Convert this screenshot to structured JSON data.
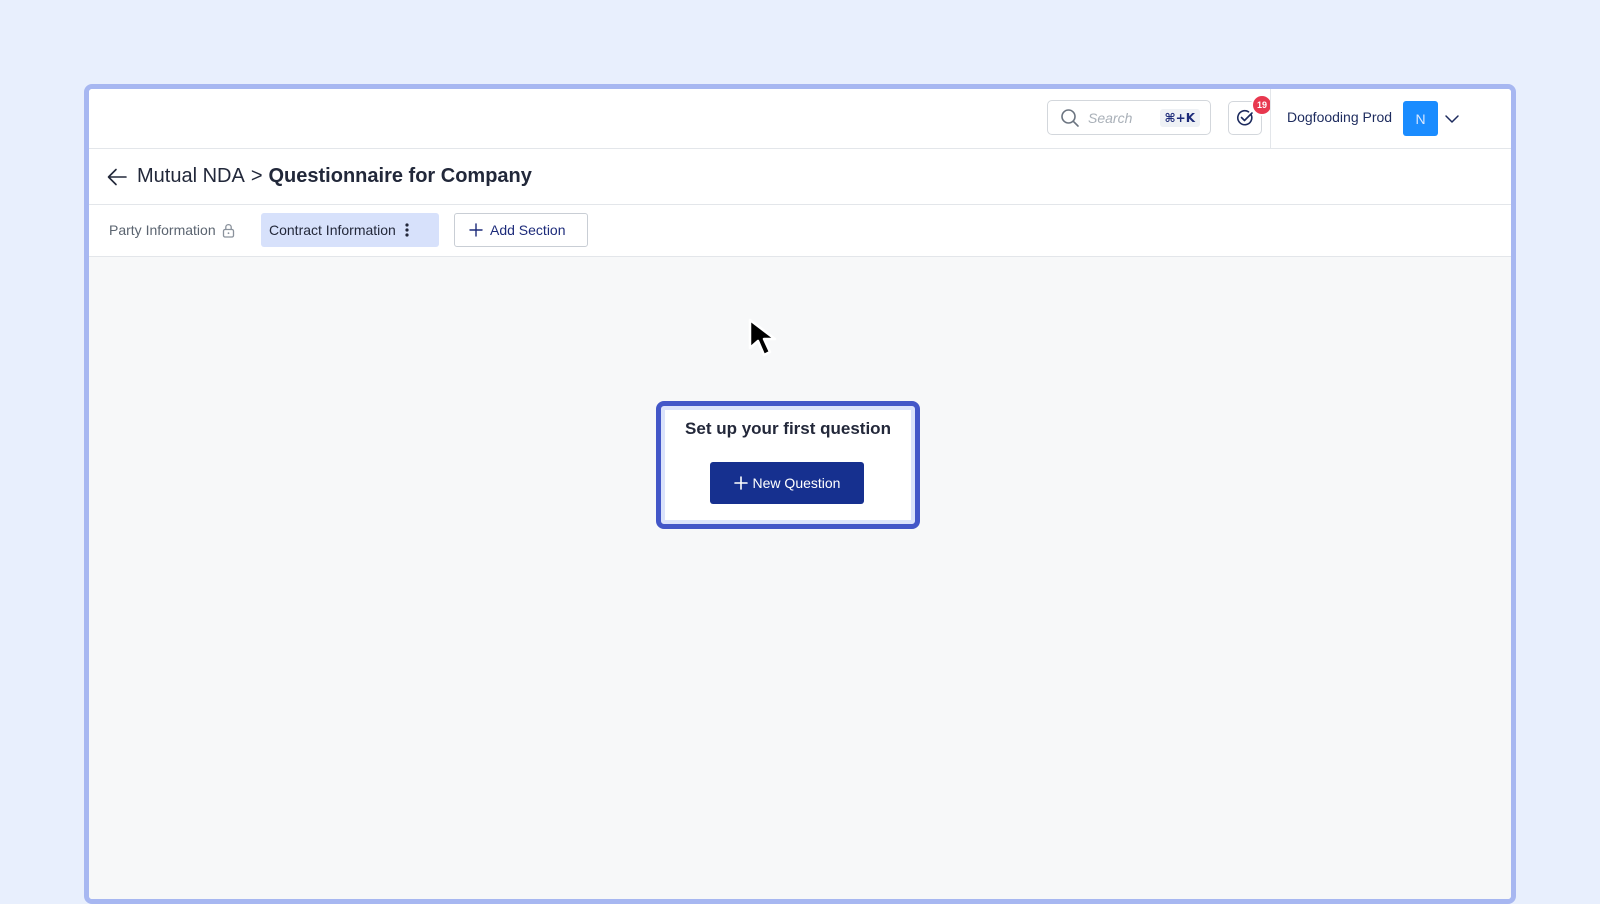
{
  "header": {
    "search": {
      "placeholder": "Search",
      "shortcut": "⌘+K"
    },
    "tasks": {
      "badge_count": "19"
    },
    "workspace": {
      "name": "Dogfooding Prod",
      "avatar_initial": "N"
    }
  },
  "page": {
    "breadcrumb": {
      "parent": "Mutual NDA",
      "separator": ">",
      "current": "Questionnaire for Company"
    }
  },
  "sections": {
    "tabs": [
      {
        "label": "Party Information",
        "locked": true,
        "active": false
      },
      {
        "label": "Contract Information",
        "locked": false,
        "active": true
      }
    ],
    "add_section_label": "Add Section"
  },
  "empty_state": {
    "title": "Set up your first question",
    "button_label": "New Question"
  },
  "colors": {
    "primary": "#16308f",
    "badge": "#e8384f",
    "avatar": "#1a8cff",
    "active_tab": "#d7e1fb",
    "highlight_border": "#4357c8"
  }
}
